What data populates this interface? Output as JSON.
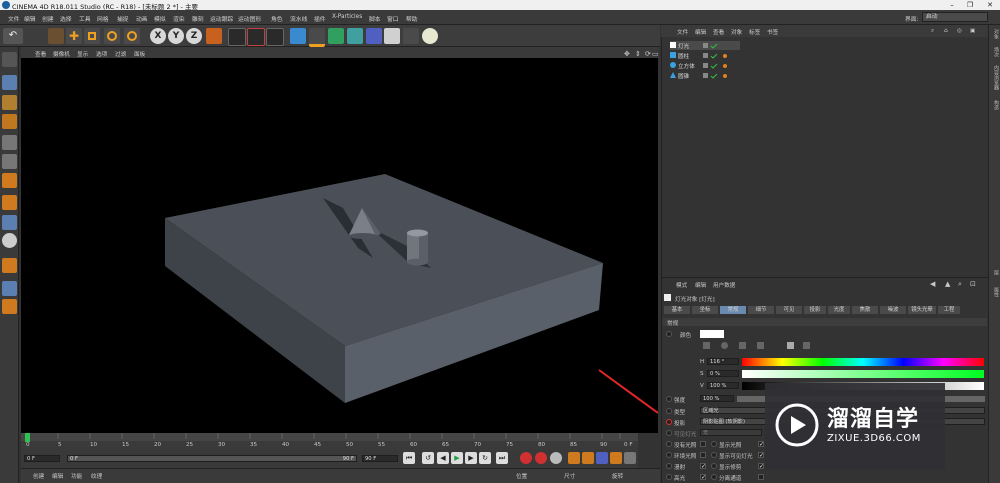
{
  "app": {
    "title": "CINEMA 4D R18.011 Studio (RC - R18) - [未标题 2 *] - 主要"
  },
  "menubar": {
    "items": [
      "文件",
      "编辑",
      "创建",
      "选择",
      "工具",
      "网格",
      "捕捉",
      "动画",
      "模拟",
      "渲染",
      "雕刻",
      "运动跟踪",
      "运动图形",
      "角色",
      "流水线",
      "插件",
      "X-Particles",
      "脚本",
      "窗口",
      "帮助"
    ],
    "layout_label": "界面:",
    "layout_value": "启动"
  },
  "toolbar": {
    "axis_x": "X",
    "axis_y": "Y",
    "axis_z": "Z"
  },
  "viewport": {
    "menu": [
      "查看",
      "摄像机",
      "显示",
      "选项",
      "过滤",
      "面板"
    ]
  },
  "timeline": {
    "ticks": [
      "0",
      "5",
      "10",
      "15",
      "20",
      "25",
      "30",
      "35",
      "40",
      "45",
      "50",
      "55",
      "60",
      "65",
      "70",
      "75",
      "80",
      "85",
      "90"
    ],
    "end_frame": "0 F",
    "start_field": "0 F",
    "slider_start": "0 F",
    "slider_end": "90 F",
    "end_field": "90 F"
  },
  "bottom_panel": {
    "tabs": [
      "创建",
      "编辑",
      "功能",
      "纹理"
    ],
    "coord_labels": [
      "位置",
      "尺寸",
      "旋转"
    ]
  },
  "object_manager": {
    "menu": [
      "文件",
      "编辑",
      "查看",
      "对象",
      "标签",
      "书签"
    ],
    "objects": [
      {
        "name": "灯光",
        "color": "#ffffff"
      },
      {
        "name": "圆柱",
        "color": "#3aa0e0"
      },
      {
        "name": "立方体",
        "color": "#3aa0e0"
      },
      {
        "name": "圆锥",
        "color": "#3aa0e0"
      }
    ]
  },
  "right_strip": {
    "tabs": [
      "对象",
      "场次",
      "内容浏览器",
      "构造",
      "层",
      "属性"
    ]
  },
  "attributes": {
    "menu": [
      "模式",
      "编辑",
      "用户数据"
    ],
    "object_title": "灯光对象 [灯光]",
    "tabs": [
      "基本",
      "坐标",
      "常规",
      "细节",
      "可见",
      "投影",
      "光度",
      "焦散",
      "噪波",
      "镜头光晕",
      "工程"
    ],
    "section": "常规",
    "color_label": "颜色",
    "h_label": "H",
    "h_value": "116 °",
    "s_label": "S",
    "s_value": "0 %",
    "v_label": "V",
    "v_value": "100 %",
    "intensity_label": "强度",
    "intensity_value": "100 %",
    "type_label": "类型",
    "type_value": "区域光",
    "shadow_label": "投影",
    "shadow_value": "阴影贴图 (软阴影)",
    "visible_light_label": "可见灯光",
    "visible_light_value": "无",
    "checks": [
      {
        "left": "没有光照",
        "right": "显示光照"
      },
      {
        "left": "环境光照",
        "right": "显示可见灯光"
      },
      {
        "left": "漫射",
        "right": "显示修剪"
      },
      {
        "left": "高光",
        "right": "分离通道"
      }
    ]
  },
  "watermark": {
    "brand": "溜溜自学",
    "url": "ZIXUE.3D66.COM"
  }
}
